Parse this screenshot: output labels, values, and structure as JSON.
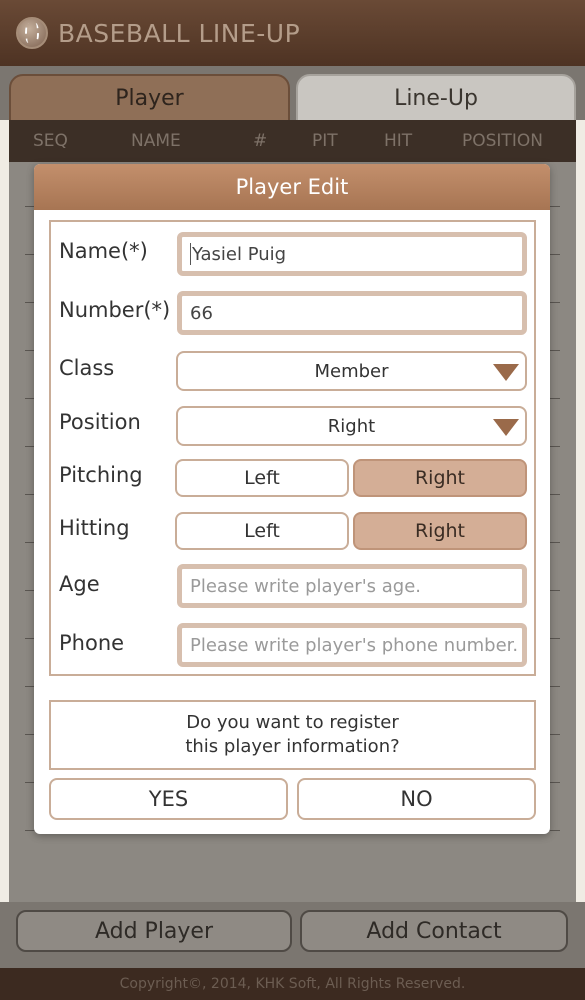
{
  "app": {
    "title": "BASEBALL LINE-UP"
  },
  "tabs": [
    {
      "label": "Player"
    },
    {
      "label": "Line-Up"
    }
  ],
  "columns": [
    "SEQ",
    "NAME",
    "#",
    "PIT",
    "HIT",
    "POSITION"
  ],
  "bottom_buttons": {
    "add_player": "Add Player",
    "add_contact": "Add Contact"
  },
  "footer": {
    "copyright": "Copyright©, 2014, KHK Soft, All Rights Reserved."
  },
  "dialog": {
    "title": "Player Edit",
    "fields": {
      "name": {
        "label": "Name(*)",
        "value": "Yasiel Puig"
      },
      "number": {
        "label": "Number(*)",
        "value": "66"
      },
      "class": {
        "label": "Class",
        "value": "Member"
      },
      "position": {
        "label": "Position",
        "value": "Right"
      },
      "pitching": {
        "label": "Pitching",
        "left": "Left",
        "right": "Right",
        "selected": "Right"
      },
      "hitting": {
        "label": "Hitting",
        "left": "Left",
        "right": "Right",
        "selected": "Right"
      },
      "age": {
        "label": "Age",
        "placeholder": "Please write player's age."
      },
      "phone": {
        "label": "Phone",
        "placeholder": "Please write player's phone number."
      }
    },
    "confirm": {
      "line1": "Do you want to register",
      "line2": "this player information?"
    },
    "yes_label": "YES",
    "no_label": "NO"
  },
  "colors": {
    "brand": "#4e3323",
    "accent": "#d4ae96",
    "dialog_header": "#b47f5d"
  },
  "icons": {
    "logo": "baseball-icon",
    "dropdown": "dropdown-triangle-icon"
  }
}
